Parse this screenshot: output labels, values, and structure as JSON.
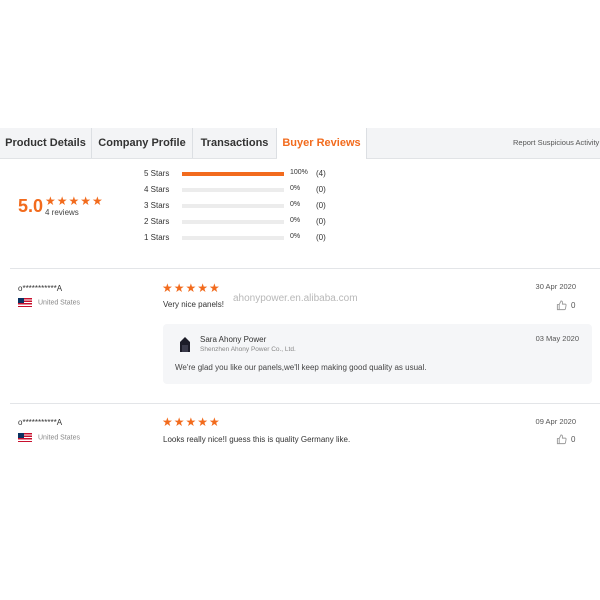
{
  "tabs": [
    {
      "label": "Product Details"
    },
    {
      "label": "Company Profile"
    },
    {
      "label": "Transactions"
    },
    {
      "label": "Buyer Reviews"
    }
  ],
  "report_label": "Report Suspicious Activity",
  "summary": {
    "score": "5.0",
    "stars": "★★★★★",
    "count_label": "4 reviews",
    "distribution": [
      {
        "label": "5 Stars",
        "percent": "100%",
        "count": "(4)",
        "fraction": 1.0
      },
      {
        "label": "4 Stars",
        "percent": "0%",
        "count": "(0)",
        "fraction": 0
      },
      {
        "label": "3 Stars",
        "percent": "0%",
        "count": "(0)",
        "fraction": 0
      },
      {
        "label": "2 Stars",
        "percent": "0%",
        "count": "(0)",
        "fraction": 0
      },
      {
        "label": "1 Stars",
        "percent": "0%",
        "count": "(0)",
        "fraction": 0
      }
    ]
  },
  "watermark": "ahonypower.en.alibaba.com",
  "reviews": [
    {
      "reviewer": "o***********A",
      "country": "United States",
      "stars": "★★★★★",
      "text": "Very nice panels!",
      "date": "30 Apr 2020",
      "likes": "0",
      "reply": {
        "name": "Sara Ahony Power",
        "company": "Shenzhen Ahony Power Co., Ltd.",
        "date": "03 May 2020",
        "text": "We're glad you like our panels,we'll keep making good quality as usual."
      }
    },
    {
      "reviewer": "o***********A",
      "country": "United States",
      "stars": "★★★★★",
      "text": "Looks really nice!I guess this is quality Germany like.",
      "date": "09 Apr 2020",
      "likes": "0"
    }
  ],
  "colors": {
    "accent": "#f26b1d",
    "bar_track": "#ececec"
  },
  "icons": {
    "like": "thumbs-up-icon",
    "flag": "us-flag-icon",
    "seller": "seller-logo-icon"
  }
}
